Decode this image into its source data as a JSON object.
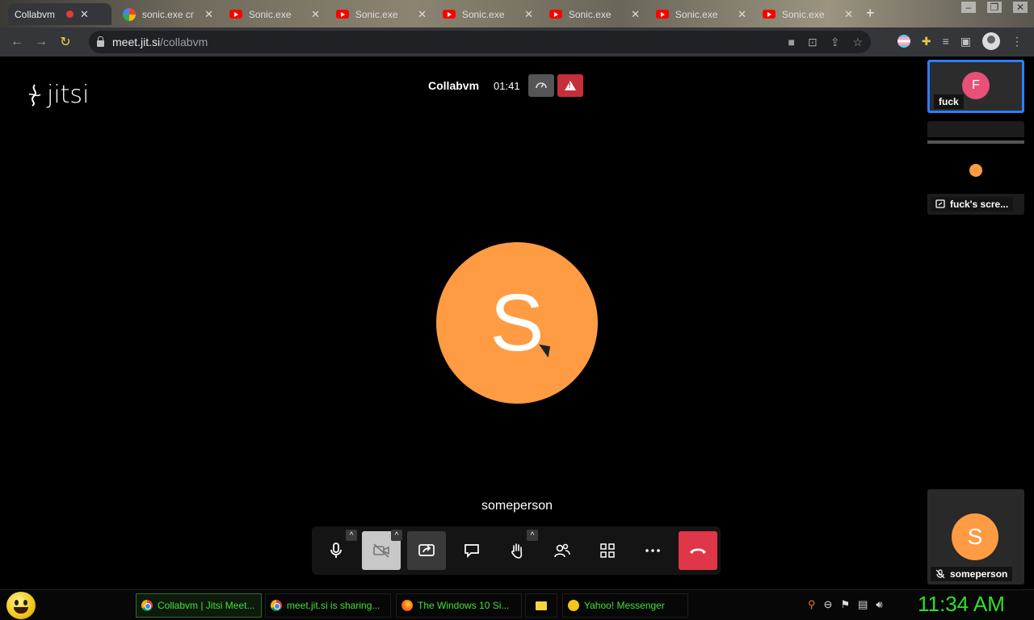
{
  "browser": {
    "tabs": [
      {
        "title": "Collabvm",
        "icon": "record-dot",
        "active": true
      },
      {
        "title": "sonic.exe cr",
        "icon": "google-icon"
      },
      {
        "title": "Sonic.exe",
        "icon": "youtube-icon"
      },
      {
        "title": "Sonic.exe",
        "icon": "youtube-icon"
      },
      {
        "title": "Sonic.exe",
        "icon": "youtube-icon"
      },
      {
        "title": "Sonic.exe",
        "icon": "youtube-icon"
      },
      {
        "title": "Sonic.exe",
        "icon": "youtube-icon"
      },
      {
        "title": "Sonic.exe",
        "icon": "youtube-icon"
      }
    ],
    "url_host": "meet.jit.si",
    "url_path": "/collabvm"
  },
  "meeting": {
    "logo_text": "jitsi",
    "room_name": "Collabvm",
    "timer": "01:41",
    "main_participant": {
      "initial": "S",
      "name": "someperson",
      "color": "#ff9b42"
    },
    "thumbnails": [
      {
        "initial": "F",
        "name": "fuck",
        "color": "#e8507a"
      },
      {
        "name": "fuck's scre..."
      },
      {
        "initial": "S",
        "name": "someperson",
        "color": "#ff9b42"
      }
    ],
    "toolbar": [
      "microphone",
      "camera",
      "share-screen",
      "chat",
      "raise-hand",
      "participants",
      "tile-view",
      "more",
      "hangup"
    ]
  },
  "taskbar": {
    "tasks": [
      {
        "label": "Collabvm | Jitsi Meet...",
        "icon": "chrome-icon"
      },
      {
        "label": "meet.jit.si is sharing...",
        "icon": "chrome-icon"
      },
      {
        "label": "The Windows 10 Si...",
        "icon": "firefox-icon"
      },
      {
        "label": "",
        "icon": "folder-icon"
      },
      {
        "label": "Yahoo! Messenger",
        "icon": "yahoo-icon"
      }
    ],
    "clock": "11:34 AM",
    "clock_color": "#2fe02a"
  }
}
